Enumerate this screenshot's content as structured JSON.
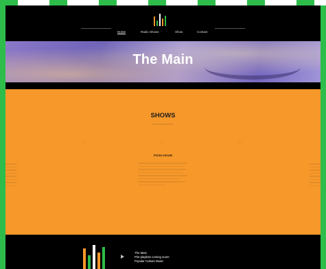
{
  "header": {
    "nav": [
      {
        "label": "Home",
        "active": true
      },
      {
        "label": "Radio Shows",
        "active": false
      },
      {
        "label": "Show",
        "active": false
      },
      {
        "label": "Contact",
        "active": false
      }
    ]
  },
  "hero": {
    "title": "The Main"
  },
  "shows_section": {
    "heading": "SHOWS",
    "featured_show": "POSH HOUR"
  },
  "footer": {
    "lines": [
      "The Main",
      "Plot playlists coming soon!",
      "Popular Culture Music"
    ]
  },
  "colors": {
    "page_border": "#2ebd4a",
    "shows_background": "#f7982a",
    "header_background": "#000000",
    "logo_bars": [
      "#f7982a",
      "#2ebd4a",
      "#ffffff",
      "#f7982a",
      "#2ebd4a"
    ]
  }
}
